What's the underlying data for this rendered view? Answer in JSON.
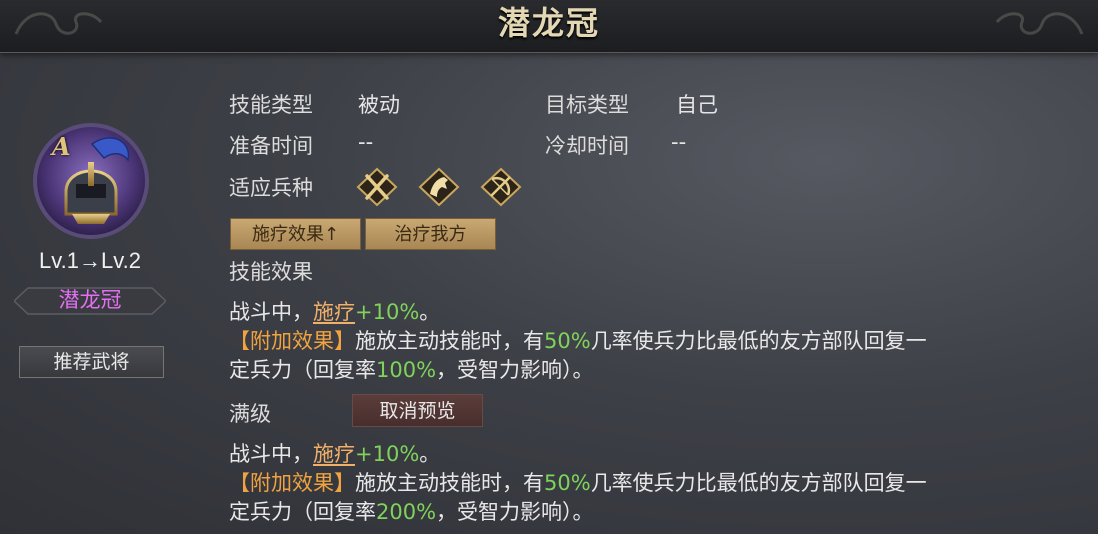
{
  "title": "潜龙冠",
  "hero": {
    "rank": "A",
    "level_text": "Lv.1→Lv.2",
    "skill_name": "潜龙冠",
    "recommend_button": "推荐武将"
  },
  "info": {
    "skill_type_label": "技能类型",
    "skill_type_value": "被动",
    "target_type_label": "目标类型",
    "target_type_value": "自己",
    "prep_time_label": "准备时间",
    "prep_time_value": "--",
    "cooldown_label": "冷却时间",
    "cooldown_value": "--",
    "troop_label": "适应兵种",
    "troop_icons": [
      "spear-icon",
      "horse-icon",
      "bow-icon"
    ]
  },
  "tags": [
    "施疗效果↑",
    "治疗我方"
  ],
  "effect_label": "技能效果",
  "current": {
    "line1_prefix": "战斗中，",
    "line1_link": "施疗",
    "line1_value": "+10%",
    "line1_suffix": "。",
    "extra_tag": "【附加效果】",
    "extra_a": "施放主动技能时，有",
    "extra_pct": "50%",
    "extra_b": "几率使兵力比最低的友方部队回复一",
    "line3_a": "定兵力（回复率",
    "line3_pct": "100%",
    "line3_b": "，受智力影响）。"
  },
  "max_label": "满级",
  "cancel_button": "取消预览",
  "max": {
    "line1_prefix": "战斗中，",
    "line1_link": "施疗",
    "line1_value": "+10%",
    "line1_suffix": "。",
    "extra_tag": "【附加效果】",
    "extra_a": "施放主动技能时，有",
    "extra_pct": "50%",
    "extra_b": "几率使兵力比最低的友方部队回复一",
    "line3_a": "定兵力（回复率",
    "line3_pct": "200%",
    "line3_b": "，受智力影响）。"
  },
  "colors": {
    "accent_gold": "#e3d7b4",
    "name_purple": "#e36ff2",
    "value_green": "#7fd35a",
    "tag_orange": "#f0a340"
  }
}
